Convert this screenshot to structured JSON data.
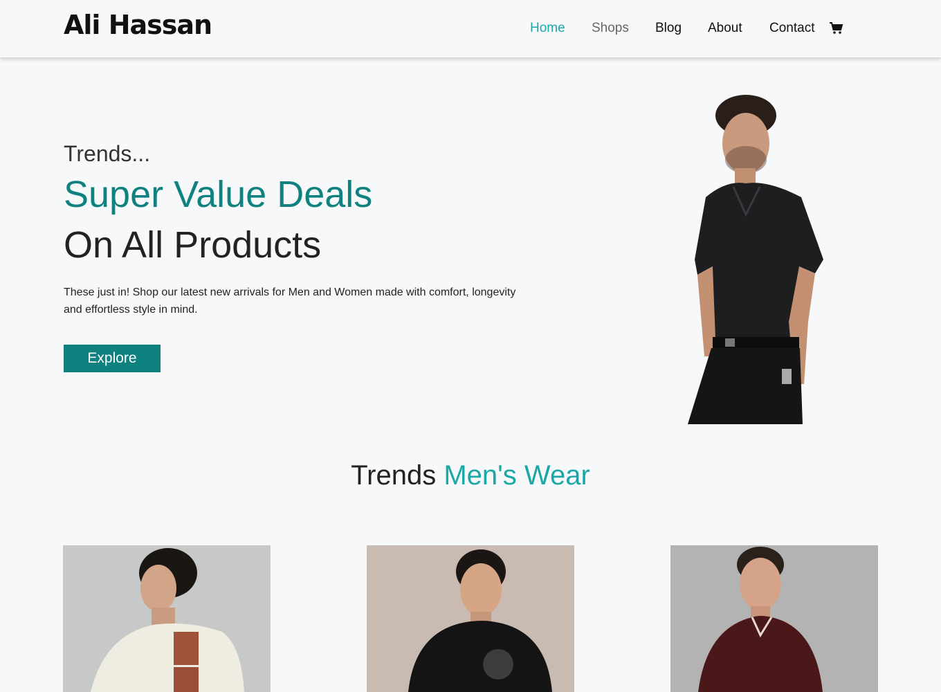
{
  "header": {
    "brand": "Ali Hassan",
    "nav": {
      "home": "Home",
      "shops": "Shops",
      "blog": "Blog",
      "about": "About",
      "contact": "Contact"
    },
    "cart_icon": "cart-icon"
  },
  "hero": {
    "kicker": "Trends...",
    "title": "Super Value Deals",
    "subtitle": "On All Products",
    "description": "These just in! Shop our latest new arrivals for Men and Women made with comfort, longevity and effortless style in mind.",
    "button": "Explore"
  },
  "section": {
    "title_prefix": "Trends",
    "title_accent": "Men's Wear"
  },
  "colors": {
    "accent": "#0f8280",
    "accent_light": "#1aa8a6",
    "background": "#f7f8fa"
  }
}
